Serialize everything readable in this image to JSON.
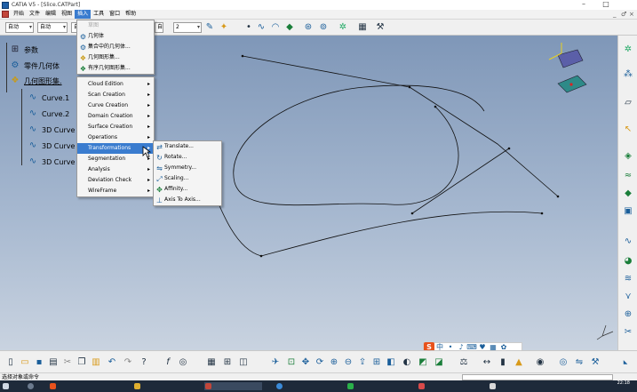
{
  "window": {
    "title": "CATIA V5 - [Slice.CATPart]",
    "controls": {
      "minimize": "–",
      "restore": "□"
    },
    "mdi_controls": {
      "minimize": "_",
      "restore": "♂",
      "close": "×"
    }
  },
  "menubar": {
    "items": [
      "开始",
      "文件",
      "编辑",
      "视图",
      "插入",
      "工具",
      "窗口",
      "帮助"
    ],
    "active_index": 4
  },
  "toolbar_top": {
    "combo1": "自动",
    "combo2": "自动",
    "combo3": "自",
    "combo4": "2"
  },
  "tree": {
    "root": "参数",
    "part_body": "零件几何体",
    "geo_set": "几何图形集.",
    "children": [
      "Curve.1",
      "Curve.2",
      "3D Curve",
      "3D Curve",
      "3D Curve"
    ]
  },
  "insert_menu": {
    "disabled_top": "草图",
    "top_items": [
      "几何体",
      "集合中的几何体...",
      "几何图形集...",
      "有序几何图形集..."
    ],
    "sub_items": [
      "Cloud Edition",
      "Scan Creation",
      "Curve Creation",
      "Domain Creation",
      "Surface Creation",
      "Operations",
      "Transformations",
      "Segmentation",
      "Analysis",
      "Deviation Check",
      "WireFrame"
    ],
    "highlighted": "Transformations"
  },
  "transformations_menu": {
    "items": [
      "Translate...",
      "Rotate...",
      "Symmetry...",
      "Scaling...",
      "Affinity...",
      "Axis To Axis..."
    ]
  },
  "statusbar": {
    "text": "选择对象或命令"
  },
  "taskbar": {
    "time": "22:18",
    "date": "2021/x/x"
  },
  "colors": {
    "menu_highlight": "#3a7ccf",
    "viewport_top": "#7f97b8",
    "viewport_bottom": "#c9d3e0",
    "taskbar": "#1e2a3a"
  },
  "icons": {
    "tree": [
      "parameters-icon",
      "part-body-icon",
      "geometrical-set-icon",
      "curve-icon"
    ],
    "compass": "compass-icon",
    "axis": "axis-triad-icon"
  }
}
